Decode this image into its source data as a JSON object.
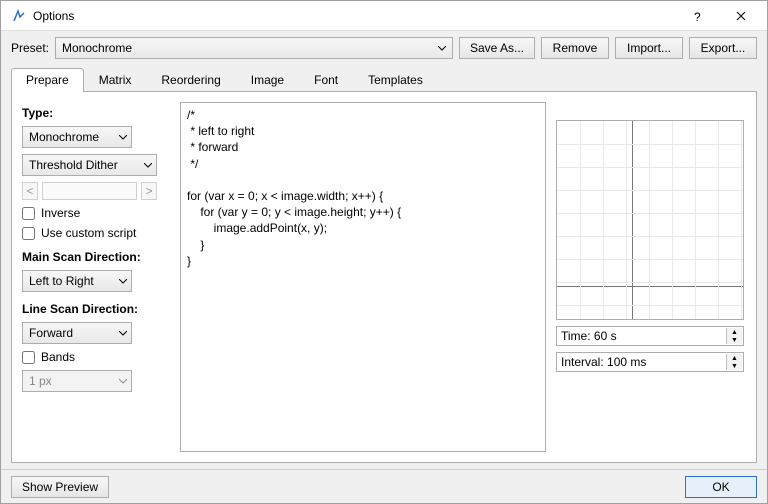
{
  "window": {
    "title": "Options"
  },
  "toolbar": {
    "preset_label": "Preset:",
    "preset_value": "Monochrome",
    "save_as": "Save As...",
    "remove": "Remove",
    "import": "Import...",
    "export": "Export..."
  },
  "tabs": [
    "Prepare",
    "Matrix",
    "Reordering",
    "Image",
    "Font",
    "Templates"
  ],
  "active_tab": 0,
  "prepare": {
    "type_label": "Type:",
    "type_value": "Monochrome",
    "dither_value": "Threshold Dither",
    "slider_left": "<",
    "slider_right": ">",
    "inverse_label": "Inverse",
    "custom_script_label": "Use custom script",
    "main_scan_label": "Main Scan Direction:",
    "main_scan_value": "Left to Right",
    "line_scan_label": "Line Scan Direction:",
    "line_scan_value": "Forward",
    "bands_label": "Bands",
    "bands_value": "1 px",
    "code": "/*\n * left to right\n * forward\n */\n\nfor (var x = 0; x < image.width; x++) {\n    for (var y = 0; y < image.height; y++) {\n        image.addPoint(x, y);\n    }\n}",
    "time_label": "Time: 60 s",
    "interval_label": "Interval: 100 ms"
  },
  "footer": {
    "show_preview": "Show Preview",
    "ok": "OK"
  }
}
